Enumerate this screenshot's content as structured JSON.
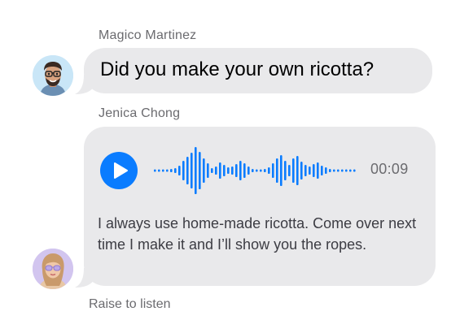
{
  "messages": [
    {
      "sender": "Magico Martinez",
      "text": "Did you make your own ricotta?"
    },
    {
      "sender": "Jenica Chong",
      "audio_duration": "00:09",
      "transcript": "I always use home-made ricotta. Come over next time I make it and I’ll show you the ropes."
    }
  ],
  "status": "Raise to listen",
  "colors": {
    "accent": "#0a7cff",
    "bubble": "#e9e9eb",
    "secondary_text": "#6b6b6f"
  }
}
